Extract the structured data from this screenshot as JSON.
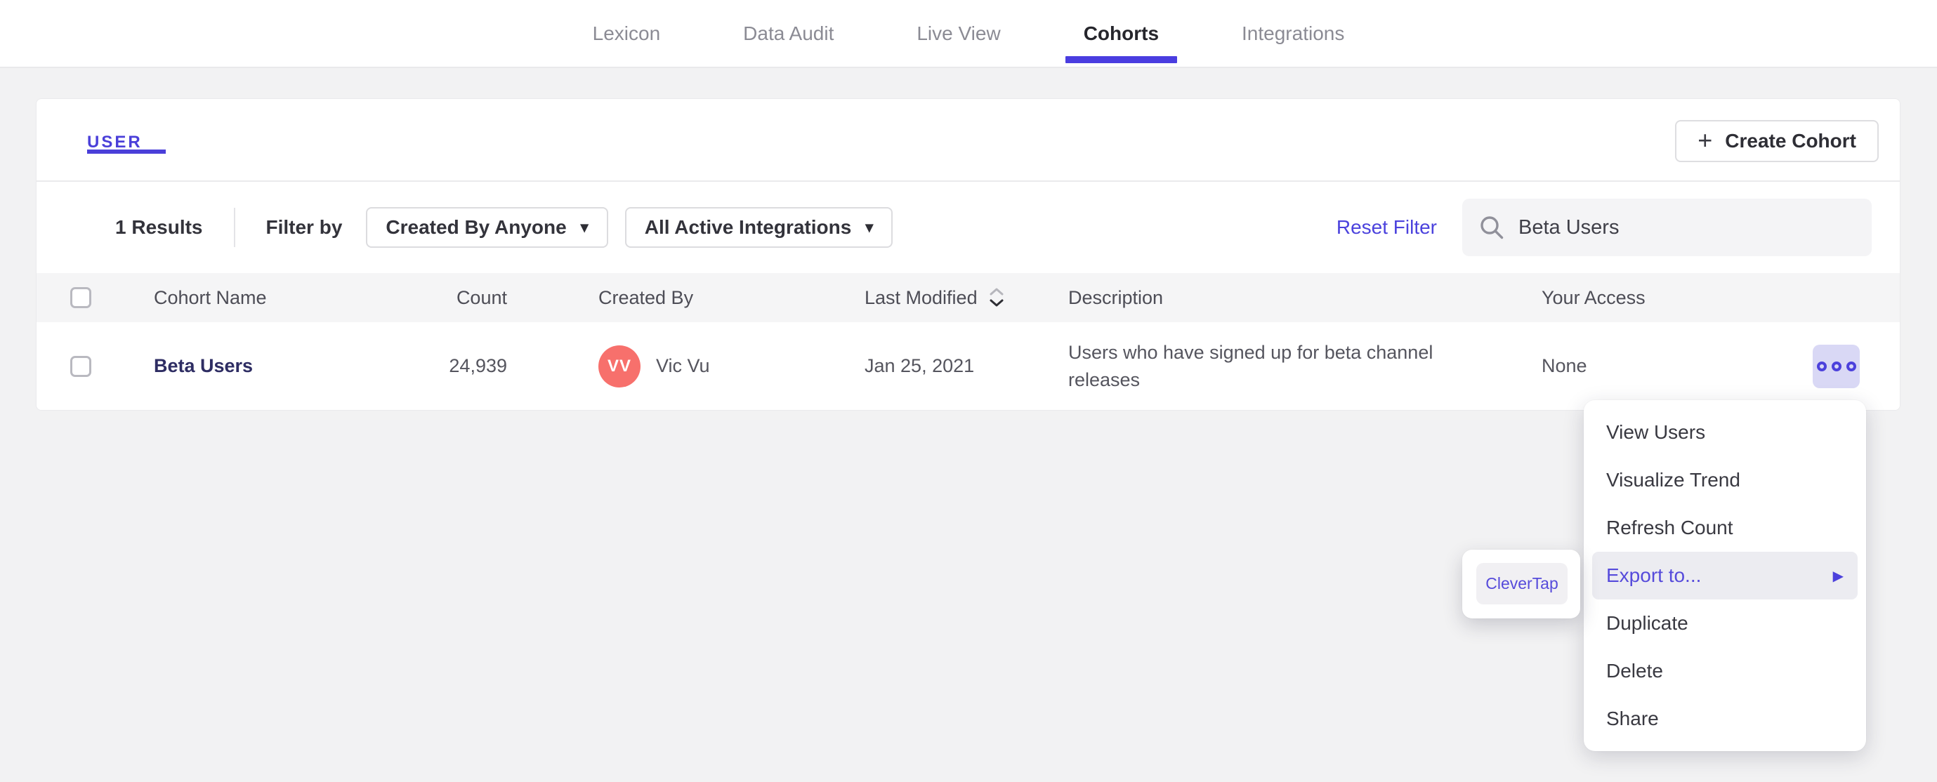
{
  "nav": {
    "tabs": [
      {
        "label": "Lexicon",
        "active": false
      },
      {
        "label": "Data Audit",
        "active": false
      },
      {
        "label": "Live View",
        "active": false
      },
      {
        "label": "Cohorts",
        "active": true
      },
      {
        "label": "Integrations",
        "active": false
      }
    ]
  },
  "cohorts_page": {
    "type_tab": "USER",
    "create_button": "Create Cohort",
    "results_count": "1 Results",
    "filter_by": "Filter by",
    "created_by_filter": "Created By Anyone",
    "integrations_filter": "All Active Integrations",
    "reset_filter": "Reset Filter",
    "search_value": "Beta Users",
    "table": {
      "headers": {
        "cohort_name": "Cohort Name",
        "count": "Count",
        "created_by": "Created By",
        "last_modified": "Last Modified",
        "description": "Description",
        "your_access": "Your Access"
      },
      "sort": {
        "column": "Last Modified",
        "direction": "desc"
      },
      "rows": [
        {
          "name": "Beta Users",
          "count": "24,939",
          "creator_initials": "VV",
          "creator_name": "Vic Vu",
          "last_modified": "Jan 25, 2021",
          "description": "Users who have signed up for beta channel releases",
          "access": "None"
        }
      ]
    }
  },
  "context_menu": {
    "items": [
      {
        "label": "View Users"
      },
      {
        "label": "Visualize Trend"
      },
      {
        "label": "Refresh Count"
      },
      {
        "label": "Export to...",
        "highlighted": true,
        "has_submenu": true
      },
      {
        "label": "Duplicate"
      },
      {
        "label": "Delete"
      },
      {
        "label": "Share"
      }
    ],
    "submenu": {
      "items": [
        {
          "label": "CleverTap"
        }
      ]
    }
  },
  "icons": {
    "plus": "+",
    "caret_down": "▾",
    "submenu_arrow": "▶",
    "more_dots": "ooo",
    "search": "magnifier",
    "sort": "up-down-chevrons"
  },
  "colors": {
    "accent_purple": "#4a3fd9",
    "tab_underline": "#4a3de0",
    "link_navy": "#2e2d63",
    "avatar_coral": "#f7706c",
    "more_button_bg": "#d9d8f5",
    "menu_highlight_bg": "#ececf1",
    "header_row_bg": "#f5f5f6",
    "page_bg": "#f2f2f3"
  }
}
